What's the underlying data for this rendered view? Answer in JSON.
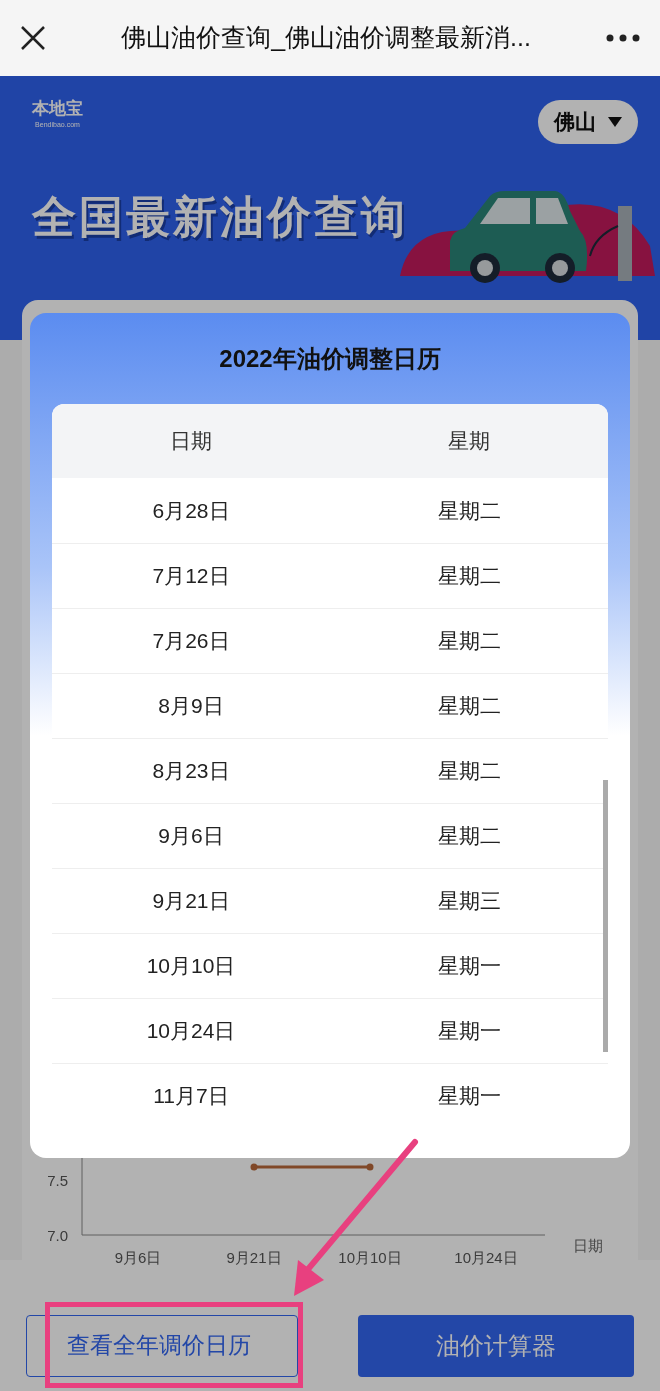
{
  "top_bar": {
    "title": "佛山油价查询_佛山油价调整最新消..."
  },
  "banner": {
    "logo": "本地宝",
    "logo_domain": "Bendibao.com",
    "city": "佛山",
    "headline": "全国最新油价查询"
  },
  "chart": {
    "xaxis_title": "日期",
    "chart_data": {
      "type": "line",
      "categories": [
        "9月6日",
        "9月21日",
        "10月10日",
        "10月24日"
      ],
      "yticks": [
        {
          "value": 7,
          "label": "7.0"
        },
        {
          "value": 7.5,
          "label": "7.5"
        }
      ],
      "ylim": [
        7.0,
        8.15
      ],
      "series": [
        {
          "color": "#b8683a",
          "marker": "circle",
          "values": [
            null,
            7.62,
            7.62,
            null
          ]
        }
      ]
    }
  },
  "modal": {
    "title": "2022年油价调整日历",
    "columns": [
      "日期",
      "星期"
    ],
    "rows": [
      [
        "6月28日",
        "星期二"
      ],
      [
        "7月12日",
        "星期二"
      ],
      [
        "7月26日",
        "星期二"
      ],
      [
        "8月9日",
        "星期二"
      ],
      [
        "8月23日",
        "星期二"
      ],
      [
        "9月6日",
        "星期二"
      ],
      [
        "9月21日",
        "星期三"
      ],
      [
        "10月10日",
        "星期一"
      ],
      [
        "10月24日",
        "星期一"
      ],
      [
        "11月7日",
        "星期一"
      ]
    ]
  },
  "bottom_buttons": [
    {
      "label": "查看全年调价日历",
      "kind": "outline"
    },
    {
      "label": "油价计算器",
      "kind": "filled"
    }
  ]
}
